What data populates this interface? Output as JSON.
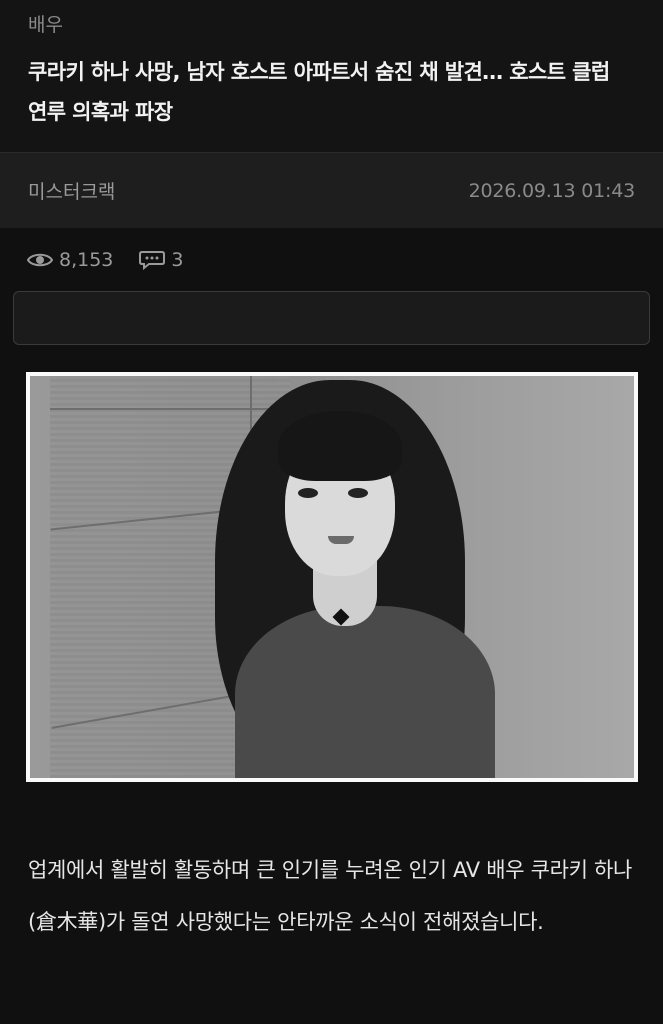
{
  "article": {
    "category": "배우",
    "title": "쿠라키 하나 사망, 남자 호스트 아파트서 숨진 채 발견… 호스트 클럽 연루 의혹과 파장",
    "author": "미스터크랙",
    "datetime": "2026.09.13 01:43",
    "views": "8,153",
    "comments": "3",
    "body": "업계에서 활발히 활동하며 큰 인기를 누려온 인기 AV 배우 쿠라키 하나(倉木華)가 돌연 사망했다는 안타까운 소식이 전해졌습니다."
  },
  "icons": {
    "views": "eye-icon",
    "comments": "comment-bubble-icon"
  },
  "colors": {
    "background": "#101010",
    "meta_bar": "#1e1e1e",
    "title_text": "#f2f2f2",
    "muted_text": "#8a8a8a"
  }
}
